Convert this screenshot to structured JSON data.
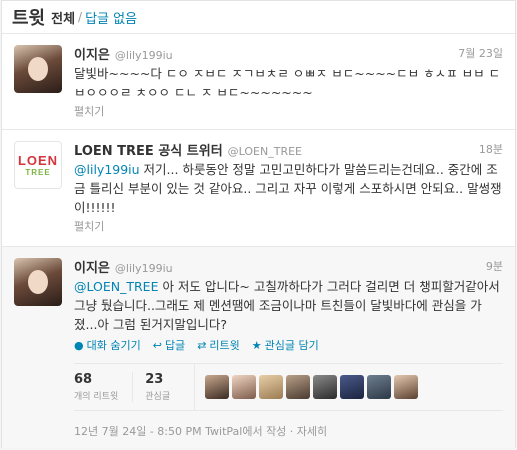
{
  "header": {
    "title": "트윗",
    "filter_all": "전체",
    "separator": "/",
    "filter_replies": "답글 없음"
  },
  "tweets": [
    {
      "name": "이지은",
      "handle": "@lily199iu",
      "time": "7월 23일",
      "text": "달빛바~~~~다 ㄷㅇ ㅈㅂㄷ ㅈㄱㅂㅊㄹ ㅇㅃㅈ ㅂㄷ~~~~ㄷㅂ ㅎㅅㅍ ㅂㅂ ㄷㅂㅇㅇㅇㄹ ㅊㅇㅇ ㄷㄴ ㅈ ㅂㄷ~~~~~~~",
      "expand": "펼치기"
    },
    {
      "name": "LOEN TREE 공식 트위터",
      "handle": "@LOEN_TREE",
      "time": "18분",
      "mention": "@lily199iu",
      "text": " 저기... 하룻동안 정말 고민고민하다가 말씀드리는건데요.. 중간에 조금 틀리신 부분이 있는 것 같아요.. 그리고 자꾸 이렇게 스포하시면 안되요.. 말썽쟁이!!!!!!",
      "expand": "펼치기",
      "logo_top": "LOEN",
      "logo_bottom": "TREE"
    },
    {
      "name": "이지은",
      "handle": "@lily199iu",
      "time": "9분",
      "mention": "@LOEN_TREE",
      "text": " 아 저도 압니다~ 고칠까하다가 그러다 걸리면 더 챙피할거같아서 그냥 뒀습니다..그래도 제 멘션땜에 조금이나마 트친들이 달빛바다에 관심을 가졌...아 그럼 된거지말입니다?",
      "actions": {
        "conversation": "대화 숨기기",
        "reply": "답글",
        "retweet": "리트윗",
        "favorite": "관심글 담기"
      },
      "stats": {
        "retweets_count": "68",
        "retweets_label": "개의 리트윗",
        "favorites_count": "23",
        "favorites_label": "관심글"
      },
      "meta": "12년 7월 24일 - 8:50 PM TwitPal에서 작성 · 자세히"
    }
  ],
  "icons": {
    "conversation": "speech-bubble-icon",
    "reply": "reply-arrow-icon",
    "retweet": "retweet-icon",
    "favorite": "star-icon"
  },
  "colors": {
    "link": "#0084b4",
    "muted": "#999999",
    "loen_red": "#d4343c",
    "loen_green": "#7cb342"
  }
}
